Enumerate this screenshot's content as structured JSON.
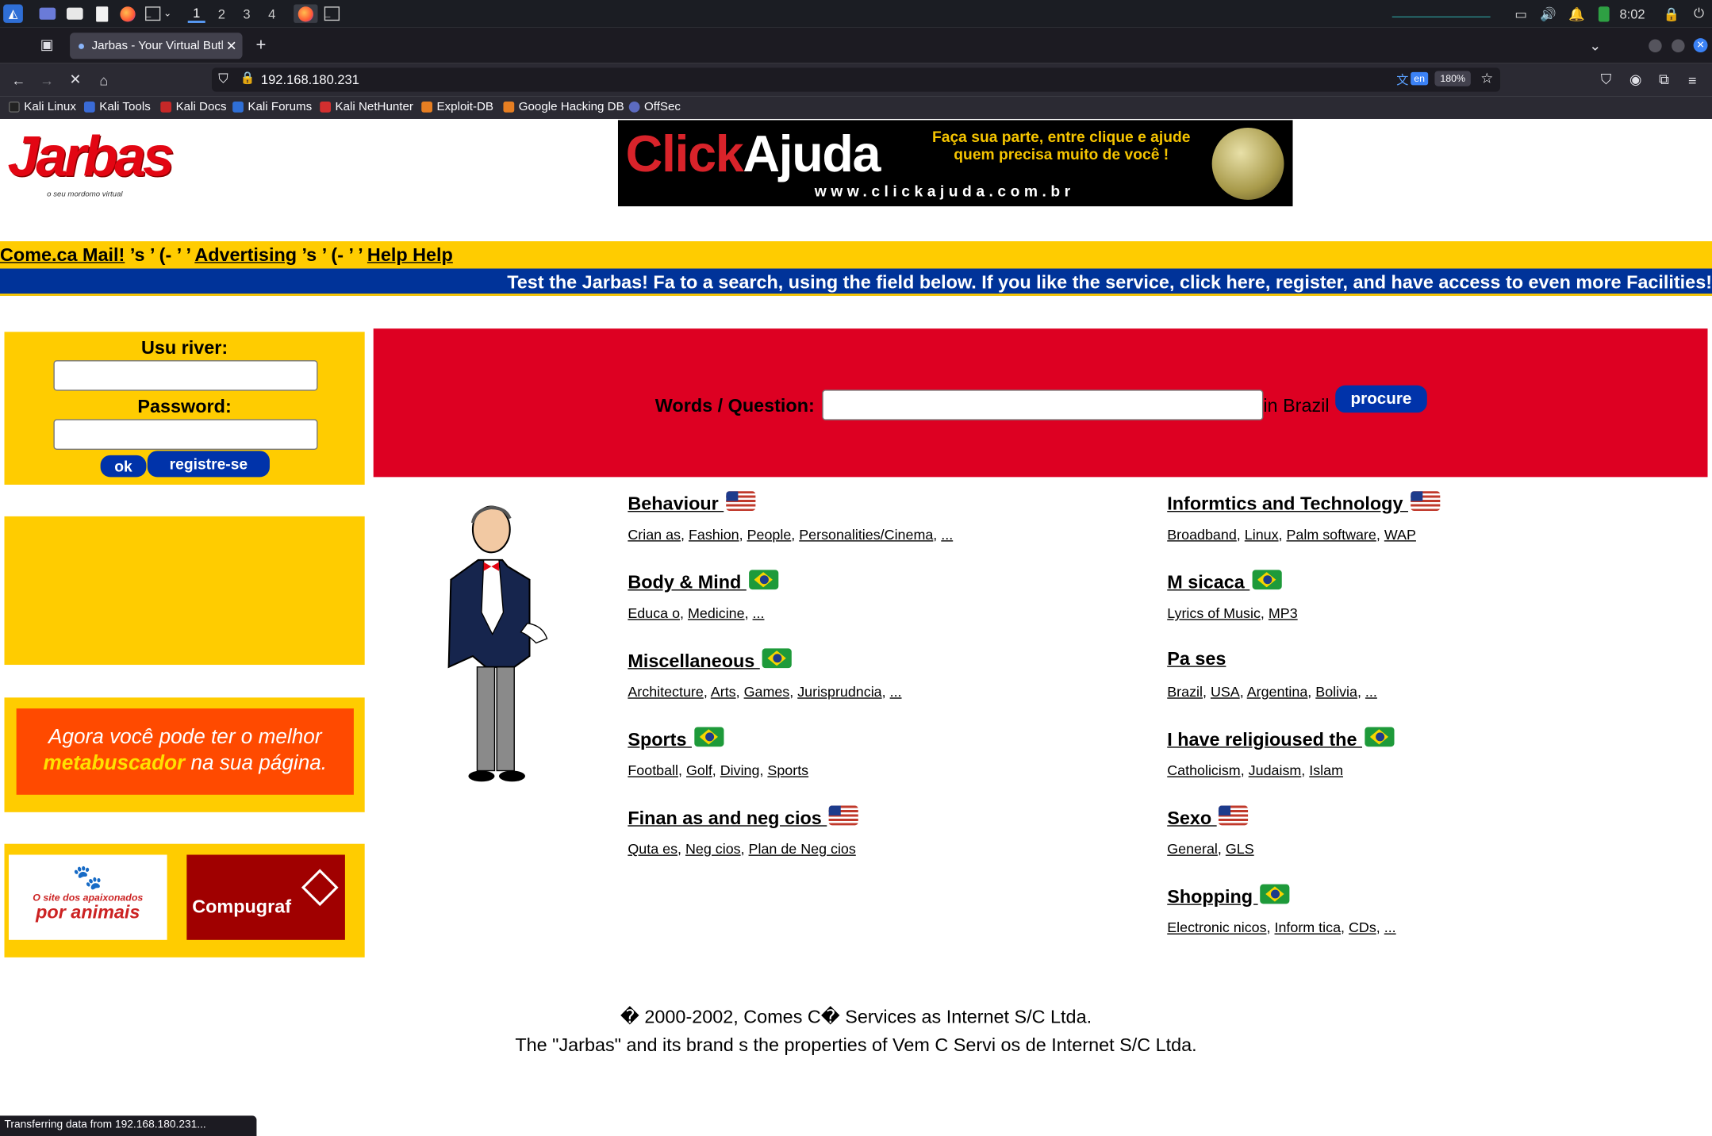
{
  "taskbar": {
    "workspaces": [
      "1",
      "2",
      "3",
      "4"
    ],
    "time": "8:02"
  },
  "browser": {
    "tab_title": "Jarbas - Your Virtual Butle",
    "url": "192.168.180.231",
    "translate_lang": "en",
    "zoom": "180%",
    "bookmarks": [
      "Kali Linux",
      "Kali Tools",
      "Kali Docs",
      "Kali Forums",
      "Kali NetHunter",
      "Exploit-DB",
      "Google Hacking DB",
      "OffSec"
    ],
    "status_text": "Transferring data from 192.168.180.231..."
  },
  "logo": {
    "title": "Jarbas",
    "tagline": "o seu mordomo virtual"
  },
  "banner": {
    "brand_click": "Click",
    "brand_ajuda": "Ajuda",
    "slogan": "Faça sua parte, entre clique e ajude quem precisa muito de você !",
    "site": "www.clickajuda.com.br"
  },
  "topnav": {
    "mail": "Come.ca Mail!",
    "sep1": " ’s ’ (- ’ ’ ",
    "advertising": "Advertising",
    "sep2": " ’s ’ (- ’ ’ ",
    "help": "Help Help"
  },
  "info_bar": "Test the Jarbas! Fa to a search, using the field below. If you like the service, click here, register, and have access to even more Facilities!",
  "login": {
    "user_label": "Usu river:",
    "password_label": "Password:",
    "ok_label": "ok",
    "register_label": "registre-se"
  },
  "ads": {
    "metabuscador_line1": "Agora você pode ter o melhor",
    "metabuscador_bold": "metabuscador",
    "metabuscador_rest": "na sua página.",
    "animais_top": "O site dos apaixonados",
    "animais_bottom": "por animais",
    "compugraf": "Compugraf"
  },
  "search": {
    "label": "Words / Question:",
    "scope": "in Brazil",
    "button": "procure"
  },
  "categories_left": [
    {
      "title": "Behaviour ",
      "flag": "us",
      "links": [
        "Crian as",
        "Fashion",
        "People",
        "Personalities/Cinema",
        "..."
      ]
    },
    {
      "title": "Body & Mind ",
      "flag": "br",
      "links": [
        "Educa o",
        "Medicine",
        "..."
      ]
    },
    {
      "title": "Miscellaneous ",
      "flag": "br",
      "links": [
        "Architecture",
        "Arts",
        "Games",
        "Jurisprudncia",
        "..."
      ]
    },
    {
      "title": "Sports ",
      "flag": "br",
      "links": [
        "Football",
        "Golf",
        "Diving",
        "Sports"
      ]
    },
    {
      "title": "Finan as and neg cios ",
      "flag": "us",
      "links": [
        "Quta es",
        "Neg cios",
        "Plan de Neg cios"
      ]
    }
  ],
  "categories_right": [
    {
      "title": "Informtics and Technology ",
      "flag": "us",
      "links": [
        "Broadband",
        "Linux",
        "Palm software",
        "WAP"
      ]
    },
    {
      "title": "M sicaca ",
      "flag": "br",
      "links": [
        "Lyrics of Music",
        "MP3"
      ]
    },
    {
      "title": "Pa ses",
      "flag": "",
      "links": [
        "Brazil",
        "USA",
        "Argentina",
        "Bolivia",
        "..."
      ]
    },
    {
      "title": "I have religioused the ",
      "flag": "br",
      "links": [
        "Catholicism",
        "Judaism",
        "Islam"
      ]
    },
    {
      "title": "Sexo ",
      "flag": "us",
      "links": [
        "General",
        "GLS"
      ]
    },
    {
      "title": "Shopping ",
      "flag": "br",
      "links": [
        "Electronic nicos",
        "Inform tica",
        "CDs",
        "..."
      ]
    }
  ],
  "footer": {
    "line1": "� 2000-2002, Comes C� Services as Internet S/C Ltda.",
    "line2": "The \"Jarbas\" and its brand s the properties of Vem C Servi os de Internet S/C Ltda."
  },
  "colors": {
    "yellow": "#ffcc00",
    "blue": "#003399",
    "red": "#dd0022"
  }
}
